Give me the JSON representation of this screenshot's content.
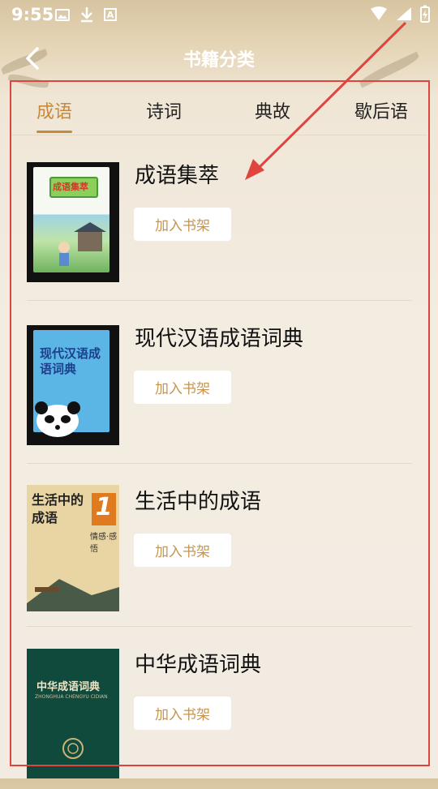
{
  "status_bar": {
    "time": "9:55",
    "left_icons": [
      "image-icon",
      "download-icon",
      "a-badge-icon"
    ],
    "right_icons": [
      "wifi-icon",
      "signal-icon",
      "battery-charging-icon"
    ]
  },
  "header": {
    "title": "书籍分类",
    "back_icon": "chevron-left-icon"
  },
  "tabs": [
    {
      "label": "成语",
      "active": true
    },
    {
      "label": "诗词",
      "active": false
    },
    {
      "label": "典故",
      "active": false
    },
    {
      "label": "歇后语",
      "active": false
    }
  ],
  "books": [
    {
      "title": "成语集萃",
      "button": "加入书架",
      "cover_text": "成语集萃"
    },
    {
      "title": "现代汉语成语词典",
      "button": "加入书架",
      "cover_text": "现代汉语成语词典"
    },
    {
      "title": "生活中的成语",
      "button": "加入书架",
      "cover_text": "生活中的成语",
      "cover_badge": "1",
      "cover_sub": "情感·感悟"
    },
    {
      "title": "中华成语词典",
      "button": "加入书架",
      "cover_text": "中华成语词典",
      "cover_sub": "ZHONGHUA CHENGYU CIDIAN"
    }
  ],
  "colors": {
    "accent": "#c58a3c",
    "button_text": "#c59550",
    "annotation": "#e0443f"
  }
}
